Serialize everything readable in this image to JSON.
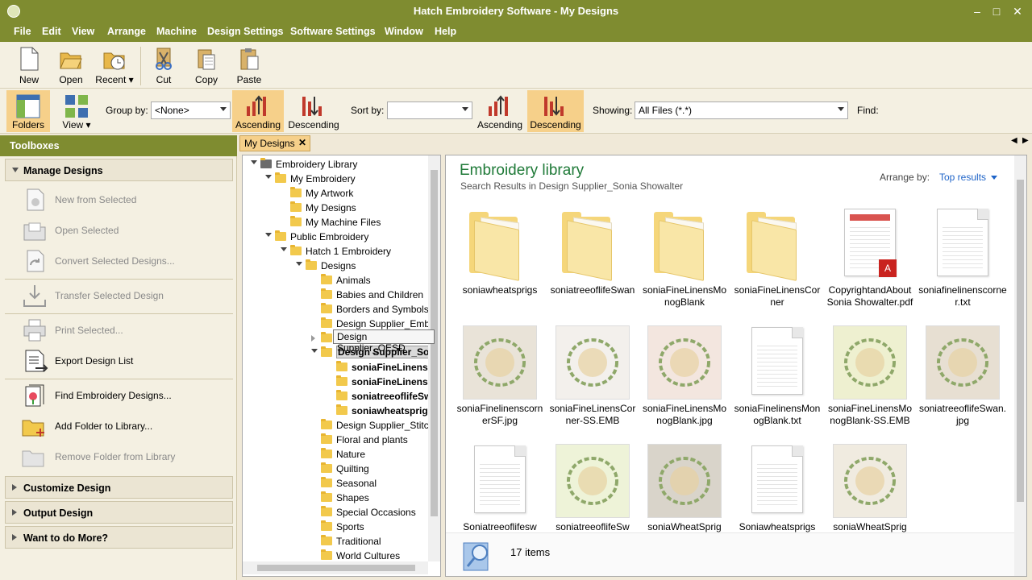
{
  "window": {
    "title": "Hatch Embroidery Software - My Designs",
    "controls": [
      "–",
      "□",
      "✕"
    ]
  },
  "menu": [
    "File",
    "Edit",
    "View",
    "Arrange",
    "Machine",
    "Design Settings",
    "Software Settings",
    "Window",
    "Help"
  ],
  "toolbar": {
    "new": "New",
    "open": "Open",
    "recent": "Recent ▾",
    "cut": "Cut",
    "copy": "Copy",
    "paste": "Paste"
  },
  "library_toolbar": {
    "folders": "Folders",
    "view": "View ▾",
    "group_by_label": "Group by:",
    "group_by_value": "<None>",
    "ascending_1": "Ascending",
    "descending_1": "Descending",
    "sort_by_label": "Sort by:",
    "sort_by_value": "",
    "ascending_2": "Ascending",
    "descending_2": "Descending",
    "showing_label": "Showing:",
    "showing_value": "All Files (*.*)",
    "find_label": "Find:"
  },
  "toolboxes": {
    "header": "Toolboxes",
    "manage_designs": "Manage Designs",
    "tools": [
      {
        "label": "New from Selected",
        "disabled": true
      },
      {
        "label": "Open Selected",
        "disabled": true
      },
      {
        "label": "Convert Selected Designs...",
        "disabled": true
      },
      {
        "label": "Transfer Selected Design",
        "disabled": true
      },
      {
        "label": "Print Selected...",
        "disabled": true
      },
      {
        "label": "Export Design List",
        "disabled": false
      },
      {
        "label": "Find Embroidery Designs...",
        "disabled": false
      },
      {
        "label": "Add Folder to Library...",
        "disabled": false
      },
      {
        "label": "Remove Folder from Library",
        "disabled": true
      }
    ],
    "customize_design": "Customize Design",
    "output_design": "Output Design",
    "want_more": "Want to do More?"
  },
  "tab": {
    "label": "My Designs",
    "close": "✕"
  },
  "tree": [
    {
      "label": "Embroidery Library",
      "level": 0,
      "expanded": true,
      "type": "root"
    },
    {
      "label": "My Embroidery",
      "level": 1,
      "expanded": true
    },
    {
      "label": "My Artwork",
      "level": 2
    },
    {
      "label": "My Designs",
      "level": 2
    },
    {
      "label": "My Machine Files",
      "level": 2
    },
    {
      "label": "Public Embroidery",
      "level": 1,
      "expanded": true
    },
    {
      "label": "Hatch 1 Embroidery",
      "level": 2,
      "expanded": true
    },
    {
      "label": "Designs",
      "level": 3,
      "expanded": true
    },
    {
      "label": "Animals",
      "level": 4
    },
    {
      "label": "Babies and Children",
      "level": 4
    },
    {
      "label": "Borders and Symbols",
      "level": 4
    },
    {
      "label": "Design Supplier_Emb",
      "level": 4
    },
    {
      "label": "Design Supplier_OESD",
      "level": 4,
      "collapsed": true
    },
    {
      "label": "Design Supplier_Son",
      "level": 4,
      "expanded": true,
      "bold": true,
      "selected": true
    },
    {
      "label": "soniaFineLinensC",
      "level": 5,
      "bold": true
    },
    {
      "label": "soniaFineLinensM",
      "level": 5,
      "bold": true
    },
    {
      "label": "soniatreeoflifeSw",
      "level": 5,
      "bold": true
    },
    {
      "label": "soniawheatsprigs",
      "level": 5,
      "bold": true
    },
    {
      "label": "Design Supplier_Stitcl",
      "level": 4
    },
    {
      "label": "Floral and plants",
      "level": 4
    },
    {
      "label": "Nature",
      "level": 4
    },
    {
      "label": "Quilting",
      "level": 4
    },
    {
      "label": "Seasonal",
      "level": 4
    },
    {
      "label": "Shapes",
      "level": 4
    },
    {
      "label": "Special Occasions",
      "level": 4
    },
    {
      "label": "Sports",
      "level": 4
    },
    {
      "label": "Traditional",
      "level": 4
    },
    {
      "label": "World Cultures",
      "level": 4
    }
  ],
  "tooltip": "Design Supplier_OESD",
  "library": {
    "title": "Embroidery library",
    "subtitle": "Search Results in Design Supplier_Sonia Showalter",
    "arrange_label": "Arrange by:",
    "arrange_value": "Top results",
    "items": [
      {
        "name": "soniawheatsprigs",
        "kind": "folder"
      },
      {
        "name": "soniatreeoflifeSwan",
        "kind": "folder"
      },
      {
        "name": "soniaFineLinensMonogBlank",
        "kind": "folder"
      },
      {
        "name": "soniaFineLinensCorner",
        "kind": "folder"
      },
      {
        "name": "CopyrightandAbout Sonia Showalter.pdf",
        "kind": "pdf"
      },
      {
        "name": "soniafinelinenscorner.txt",
        "kind": "doc"
      },
      {
        "name": "soniaFinelinenscornerSF.jpg",
        "kind": "photo",
        "color": "#e9e3d8"
      },
      {
        "name": "soniaFineLinensCorner-SS.EMB",
        "kind": "photo",
        "color": "#f3f0ec"
      },
      {
        "name": "soniaFineLinensMonogBlank.jpg",
        "kind": "photo",
        "color": "#f3e6df"
      },
      {
        "name": "soniaFinelinensMonogBlank.txt",
        "kind": "doc"
      },
      {
        "name": "soniaFineLinensMonogBlank-SS.EMB",
        "kind": "photo",
        "color": "#eef0d0"
      },
      {
        "name": "soniatreeoflifeSwan.jpg",
        "kind": "photo",
        "color": "#e7dfd2"
      },
      {
        "name": "Soniatreeoflifesw",
        "kind": "doc"
      },
      {
        "name": "soniatreeoflifeSw",
        "kind": "photo",
        "color": "#eef3d8"
      },
      {
        "name": "soniaWheatSprig",
        "kind": "photo",
        "color": "#d9d4ca"
      },
      {
        "name": "Soniawheatsprigs",
        "kind": "doc"
      },
      {
        "name": "soniaWheatSprig",
        "kind": "photo",
        "color": "#f0ebe0"
      }
    ],
    "item_count": "17 items"
  }
}
